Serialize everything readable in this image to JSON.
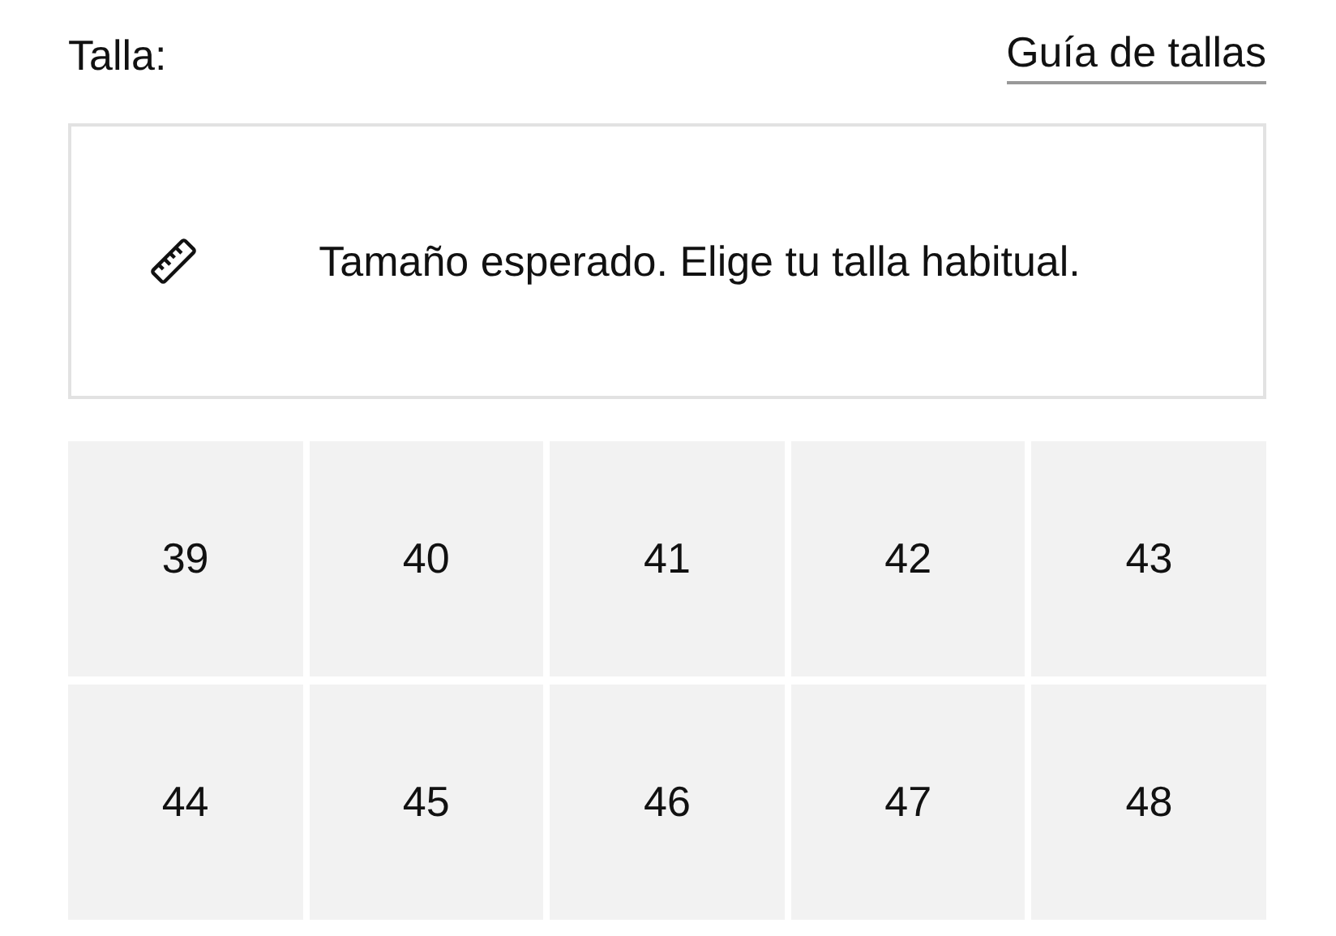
{
  "header": {
    "label": "Talla:",
    "link": "Guía de tallas"
  },
  "fit_note": {
    "text": "Tamaño esperado. Elige tu talla habitual."
  },
  "sizes": [
    "39",
    "40",
    "41",
    "42",
    "43",
    "44",
    "45",
    "46",
    "47",
    "48"
  ]
}
